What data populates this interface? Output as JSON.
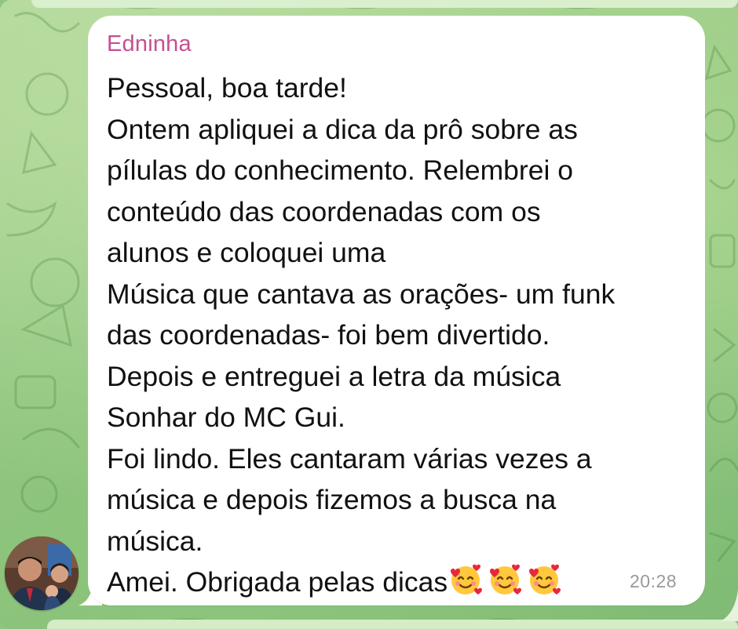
{
  "chat": {
    "background_color": "#8fc682",
    "accent_color": "#c64f91"
  },
  "message": {
    "sender": "Edninha",
    "lines": [
      "Pessoal, boa tarde!",
      "Ontem apliquei a dica da prô sobre as",
      "pílulas do conhecimento.  Relembrei o",
      "conteúdo das coordenadas com os",
      "alunos e coloquei uma",
      "Música que cantava as orações- um funk",
      "das coordenadas- foi bem divertido.",
      "Depois e entreguei a letra da música",
      "Sonhar do MC Gui.",
      "Foi lindo. Eles cantaram várias vezes a",
      "música e depois fizemos a busca na",
      "música.",
      "Amei. Obrigada pelas dicas"
    ],
    "emojis": [
      "smiling-face-with-hearts",
      "smiling-face-with-hearts",
      "smiling-face-with-hearts"
    ],
    "time": "20:28"
  },
  "avatar": {
    "icon": "sender-avatar-photo"
  }
}
